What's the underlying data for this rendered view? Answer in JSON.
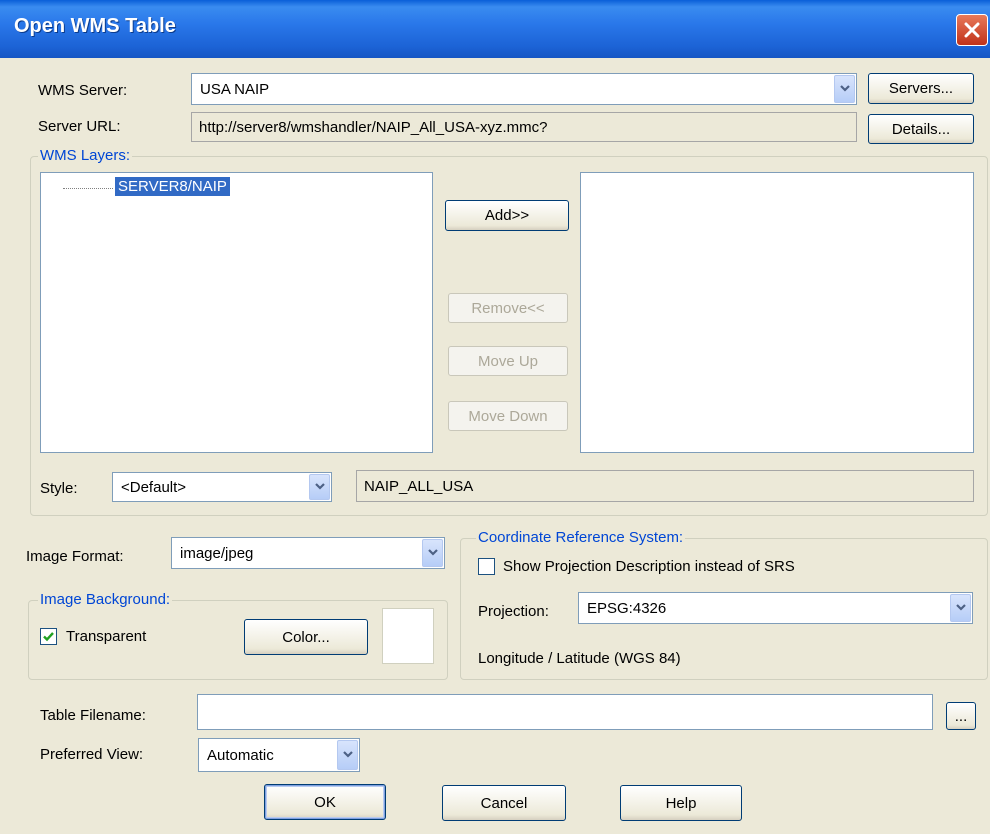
{
  "dialog": {
    "title": "Open WMS Table"
  },
  "server": {
    "label": "WMS Server:",
    "value": "USA NAIP",
    "servers_button": "Servers...",
    "url_label": "Server URL:",
    "url_value": "http://server8/wmshandler/NAIP_All_USA-xyz.mmc?",
    "details_button": "Details..."
  },
  "layers": {
    "legend": "WMS Layers:",
    "tree_item": "SERVER8/NAIP",
    "add_button": "Add>>",
    "remove_button": "Remove<<",
    "move_up_button": "Move Up",
    "move_down_button": "Move Down",
    "style_label": "Style:",
    "style_value": "<Default>",
    "layer_name": "NAIP_ALL_USA"
  },
  "image": {
    "format_label": "Image Format:",
    "format_value": "image/jpeg",
    "background_legend": "Image Background:",
    "transparent_label": "Transparent",
    "transparent_checked": true,
    "color_button": "Color..."
  },
  "crs": {
    "legend": "Coordinate Reference System:",
    "show_projection_label": "Show Projection Description instead of SRS",
    "show_projection_checked": false,
    "projection_label": "Projection:",
    "projection_value": "EPSG:4326",
    "projection_description": "Longitude / Latitude (WGS 84)"
  },
  "table": {
    "filename_label": "Table Filename:",
    "filename_value": "",
    "browse_button": "...",
    "view_label": "Preferred View:",
    "view_value": "Automatic"
  },
  "footer": {
    "ok": "OK",
    "cancel": "Cancel",
    "help": "Help"
  }
}
